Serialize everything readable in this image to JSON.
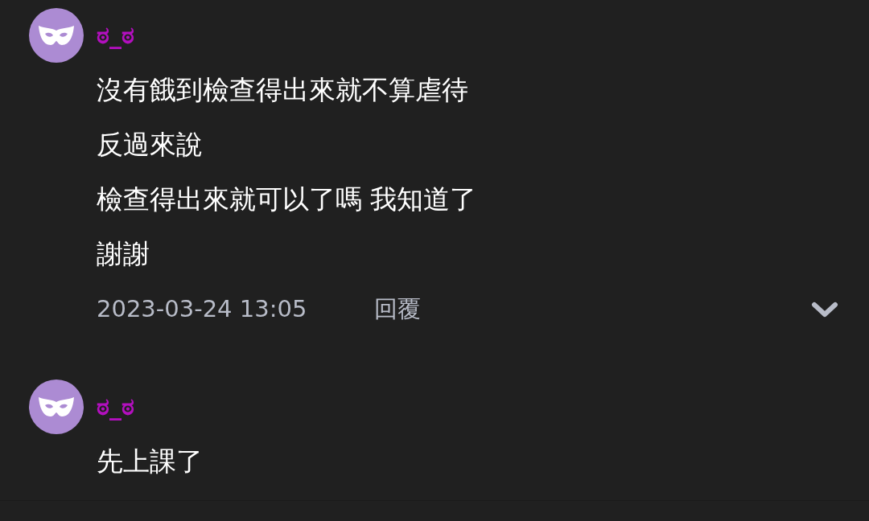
{
  "comments": [
    {
      "author": "ಠ_ಠ",
      "lines": [
        "沒有餓到檢查得出來就不算虐待",
        "反過來說",
        "檢查得出來就可以了嗎 我知道了",
        "謝謝"
      ],
      "timestamp": "2023-03-24 13:05",
      "reply_label": "回覆"
    },
    {
      "author": "ಠ_ಠ",
      "lines": [
        "先上課了"
      ]
    }
  ]
}
